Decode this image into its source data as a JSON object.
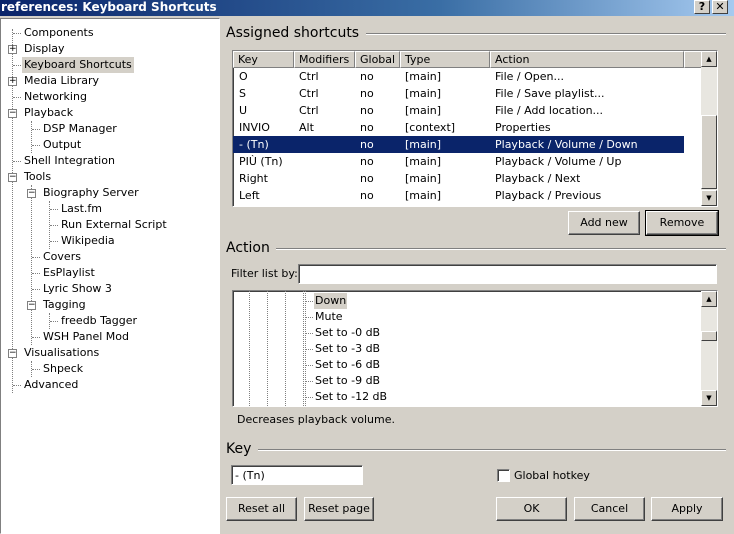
{
  "window": {
    "title": "references: Keyboard Shortcuts",
    "help_label": "?",
    "close_label": "✕"
  },
  "tree": [
    {
      "label": "Components"
    },
    {
      "label": "Display"
    },
    {
      "label": "Keyboard Shortcuts"
    },
    {
      "label": "Media Library"
    },
    {
      "label": "Networking"
    },
    {
      "label": "Playback"
    },
    {
      "label": "DSP Manager"
    },
    {
      "label": "Output"
    },
    {
      "label": "Shell Integration"
    },
    {
      "label": "Tools"
    },
    {
      "label": "Biography Server"
    },
    {
      "label": "Last.fm"
    },
    {
      "label": "Run External Script"
    },
    {
      "label": "Wikipedia"
    },
    {
      "label": "Covers"
    },
    {
      "label": "EsPlaylist"
    },
    {
      "label": "Lyric Show 3"
    },
    {
      "label": "Tagging"
    },
    {
      "label": "freedb Tagger"
    },
    {
      "label": "WSH Panel Mod"
    },
    {
      "label": "Visualisations"
    },
    {
      "label": "Shpeck"
    },
    {
      "label": "Advanced"
    }
  ],
  "tree_expanders": {
    "plus": "+",
    "minus": "−"
  },
  "assigned": {
    "title": "Assigned shortcuts",
    "columns": [
      "Key",
      "Modifiers",
      "Global",
      "Type",
      "Action"
    ],
    "rows": [
      [
        "O",
        "Ctrl",
        "no",
        "[main]",
        "File / Open..."
      ],
      [
        "S",
        "Ctrl",
        "no",
        "[main]",
        "File / Save playlist..."
      ],
      [
        "U",
        "Ctrl",
        "no",
        "[main]",
        "File / Add location..."
      ],
      [
        "INVIO",
        "Alt",
        "no",
        "[context]",
        "Properties"
      ],
      [
        "- (Tn)",
        "",
        "no",
        "[main]",
        "Playback / Volume / Down"
      ],
      [
        "PIÙ (Tn)",
        "",
        "no",
        "[main]",
        "Playback / Volume / Up"
      ],
      [
        "Right",
        "",
        "no",
        "[main]",
        "Playback / Next"
      ],
      [
        "Left",
        "",
        "no",
        "[main]",
        "Playback / Previous"
      ]
    ],
    "add_new_label": "Add new",
    "remove_label": "Remove"
  },
  "action": {
    "title": "Action",
    "filter_label": "Filter list by:",
    "filter_value": "",
    "items": [
      "Down",
      "Mute",
      "Set to -0 dB",
      "Set to -3 dB",
      "Set to -6 dB",
      "Set to -9 dB",
      "Set to -12 dB"
    ],
    "description": "Decreases playback volume."
  },
  "key": {
    "title": "Key",
    "value": "- (Tn)",
    "global_hotkey_label": "Global hotkey"
  },
  "scroll_arrows": {
    "up": "▲",
    "down": "▼"
  },
  "buttons": {
    "reset_all": "Reset all",
    "reset_page": "Reset page",
    "ok": "OK",
    "cancel": "Cancel",
    "apply": "Apply"
  }
}
